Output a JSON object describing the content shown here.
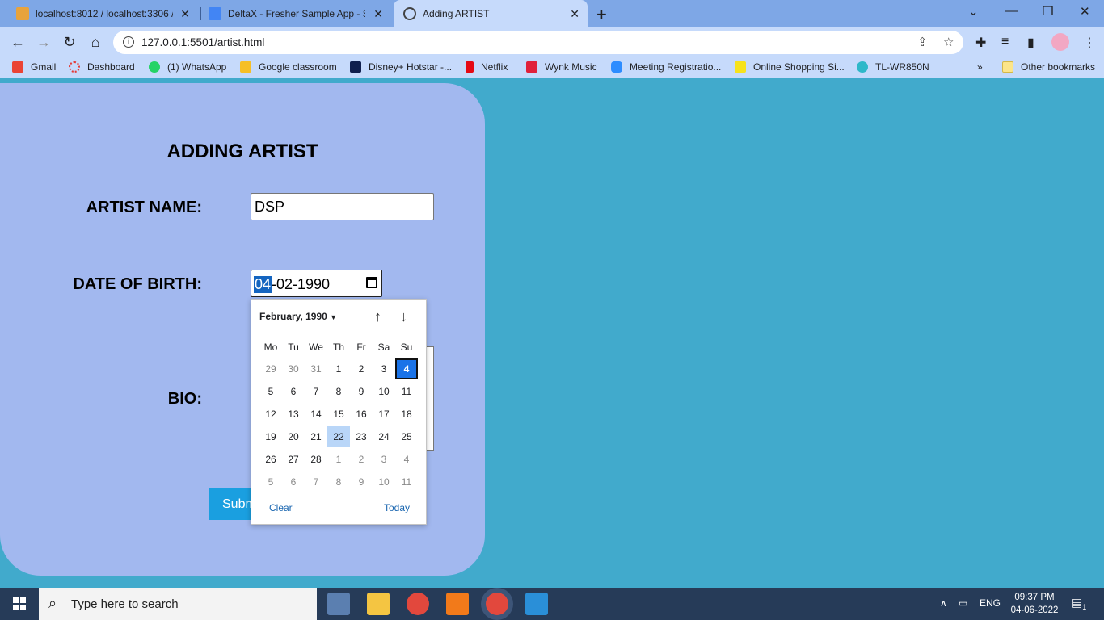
{
  "browser": {
    "tabs": [
      {
        "title": "localhost:8012 / localhost:3306 /"
      },
      {
        "title": "DeltaX - Fresher Sample App - Sp"
      },
      {
        "title": "Adding ARTIST"
      }
    ],
    "url": "127.0.0.1:5501/artist.html",
    "bookmarks": [
      {
        "label": "Gmail"
      },
      {
        "label": "Dashboard"
      },
      {
        "label": "(1) WhatsApp"
      },
      {
        "label": "Google classroom"
      },
      {
        "label": "Disney+ Hotstar -..."
      },
      {
        "label": "Netflix"
      },
      {
        "label": "Wynk Music"
      },
      {
        "label": "Meeting Registratio..."
      },
      {
        "label": "Online Shopping Si..."
      },
      {
        "label": "TL-WR850N"
      }
    ],
    "overflow": "»",
    "other_bookmarks": "Other bookmarks",
    "colors": {
      "tabbar": "#7ea7e6",
      "toolbar": "#c6dafb"
    }
  },
  "form": {
    "heading": "ADDING ARTIST",
    "artist_name_label": "ARTIST NAME:",
    "artist_name_value": "DSP",
    "dob_label": "DATE OF BIRTH:",
    "dob_day": "04",
    "dob_rest": "-02-1990",
    "bio_label": "BIO:",
    "submit_label": "Submit"
  },
  "calendar": {
    "month_label": "February, 1990",
    "weekdays": [
      "Mo",
      "Tu",
      "We",
      "Th",
      "Fr",
      "Sa",
      "Su"
    ],
    "weeks": [
      [
        "29",
        "30",
        "31",
        "1",
        "2",
        "3",
        "4"
      ],
      [
        "5",
        "6",
        "7",
        "8",
        "9",
        "10",
        "11"
      ],
      [
        "12",
        "13",
        "14",
        "15",
        "16",
        "17",
        "18"
      ],
      [
        "19",
        "20",
        "21",
        "22",
        "23",
        "24",
        "25"
      ],
      [
        "26",
        "27",
        "28",
        "1",
        "2",
        "3",
        "4"
      ],
      [
        "5",
        "6",
        "7",
        "8",
        "9",
        "10",
        "11"
      ]
    ],
    "selected_day": "4",
    "today_day": "22",
    "clear_label": "Clear",
    "today_label": "Today"
  },
  "taskbar": {
    "search_placeholder": "Type here to search",
    "language": "ENG",
    "time": "09:37 PM",
    "date": "04-06-2022",
    "notification_count": "1"
  },
  "page_colors": {
    "background": "#41aacc",
    "card": "#a2b8ef",
    "accent": "#1a9fe0"
  }
}
